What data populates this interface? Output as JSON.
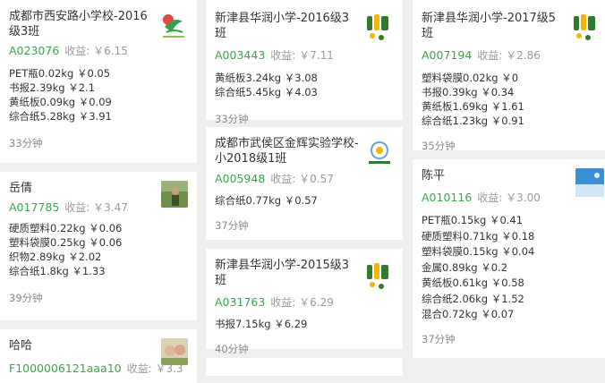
{
  "columns": [
    {
      "cards": [
        {
          "title": "成都市西安路小学校-2016级3班",
          "code": "A023076",
          "earnings": "收益: ￥6.15",
          "items": [
            "PET瓶0.02kg ￥0.05",
            "书报2.39kg ￥2.1",
            "黄纸板0.09kg ￥0.09",
            "综合纸5.28kg ￥3.91"
          ],
          "time": "33分钟",
          "image": "school-logo-green"
        },
        {
          "title": "岳倩",
          "code": "A017785",
          "earnings": "收益: ￥3.47",
          "items": [
            "硬质塑料0.22kg ￥0.06",
            "塑料袋膜0.25kg ￥0.06",
            "织物2.89kg ￥2.02",
            "综合纸1.8kg ￥1.33"
          ],
          "time": "39分钟",
          "image": "avatar-outdoor"
        },
        {
          "title": "哈哈",
          "code": "F1000006121aaa10",
          "earnings": "收益: ￥3.3",
          "items": [],
          "time": "",
          "image": "avatar-couple"
        }
      ]
    },
    {
      "cards": [
        {
          "title": "新津县华润小学-2016级3班",
          "code": "A003443",
          "earnings": "收益: ￥7.11",
          "items": [
            "黄纸板3.24kg ￥3.08",
            "综合纸5.45kg ￥4.03"
          ],
          "time": "33分钟",
          "image": "huarun-logo"
        },
        {
          "title": "成都市武侯区金辉实验学校-小2018级1班",
          "code": "A005948",
          "earnings": "收益: ￥0.57",
          "items": [
            "综合纸0.77kg ￥0.57"
          ],
          "time": "37分钟",
          "image": "jinhui-logo"
        },
        {
          "title": "新津县华润小学-2015级3班",
          "code": "A031763",
          "earnings": "收益: ￥6.29",
          "items": [
            "书报7.15kg ￥6.29"
          ],
          "time": "40分钟",
          "image": "huarun-logo"
        }
      ]
    },
    {
      "cards": [
        {
          "title": "新津县华润小学-2017级5班",
          "code": "A007194",
          "earnings": "收益: ￥2.86",
          "items": [
            "塑料袋膜0.02kg ￥0",
            "书报0.39kg ￥0.34",
            "黄纸板1.69kg ￥1.61",
            "综合纸1.23kg ￥0.91"
          ],
          "time": "35分钟",
          "image": "huarun-logo"
        },
        {
          "title": "陈平",
          "code": "A010116",
          "earnings": "收益: ￥3.00",
          "items": [
            "PET瓶0.15kg ￥0.41",
            "硬质塑料0.71kg ￥0.18",
            "塑料袋膜0.15kg ￥0.04",
            "金属0.89kg ￥0.2",
            "黄纸板0.61kg ￥0.58",
            "综合纸2.06kg ￥1.52",
            "混合0.72kg ￥0.07"
          ],
          "time": "37分钟",
          "image": "avatar-sky"
        }
      ]
    }
  ]
}
